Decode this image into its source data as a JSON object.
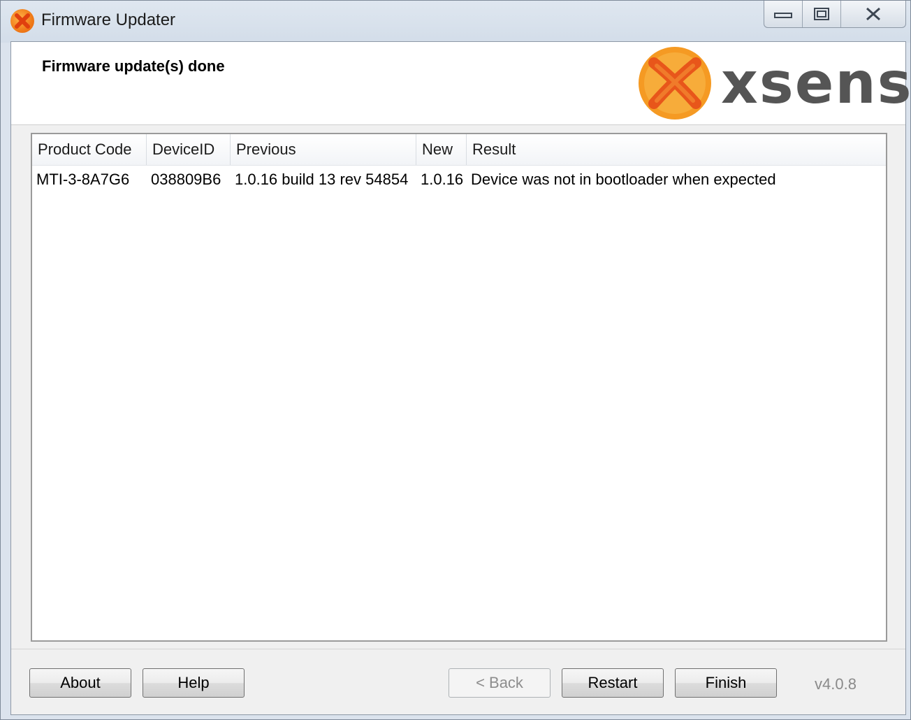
{
  "window": {
    "title": "Firmware Updater",
    "controls": [
      "minimize",
      "maximize",
      "close"
    ]
  },
  "header": {
    "title": "Firmware update(s) done",
    "logo_text": "xsens",
    "brand_color": "#f07b19"
  },
  "table": {
    "columns": [
      "Product Code",
      "DeviceID",
      "Previous",
      "New",
      "Result"
    ],
    "rows": [
      {
        "product_code": "MTI-3-8A7G6",
        "device_id": "038809B6",
        "previous": "1.0.16 build 13 rev 54854",
        "new": "1.0.16",
        "result": "Device was not in bootloader when expected"
      }
    ]
  },
  "footer": {
    "about_label": "About",
    "help_label": "Help",
    "back_label": "< Back",
    "restart_label": "Restart",
    "finish_label": "Finish",
    "version": "v4.0.8"
  }
}
